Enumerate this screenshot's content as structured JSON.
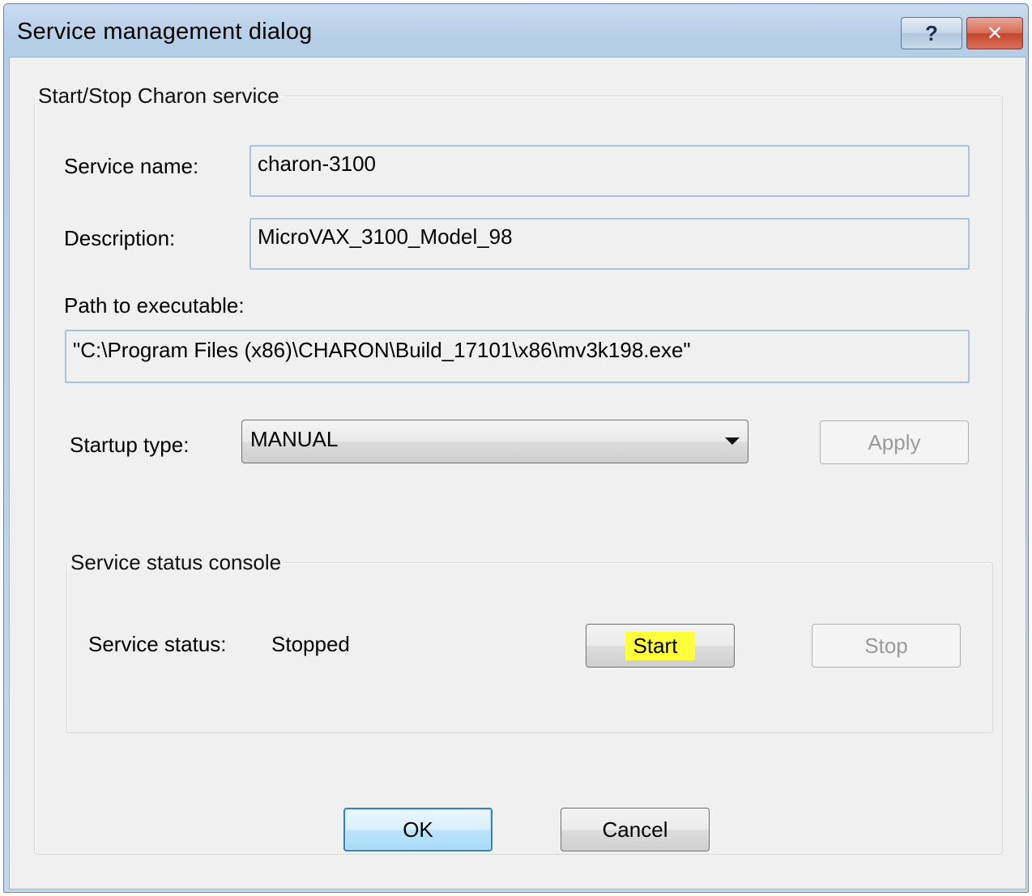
{
  "window": {
    "title": "Service management dialog",
    "help_label": "?",
    "close_label": "✕"
  },
  "service_group": {
    "legend": "Start/Stop Charon service",
    "service_name_label": "Service name:",
    "service_name_value": "charon-3100",
    "description_label": "Description:",
    "description_value": "MicroVAX_3100_Model_98",
    "path_label": "Path to executable:",
    "path_value": "\"C:\\Program Files (x86)\\CHARON\\Build_17101\\x86\\mv3k198.exe\"",
    "startup_label": "Startup type:",
    "startup_value": "MANUAL",
    "apply_label": "Apply"
  },
  "status_group": {
    "legend": "Service status console",
    "status_label": "Service status:",
    "status_value": "Stopped",
    "start_label": "Start",
    "stop_label": "Stop"
  },
  "footer": {
    "ok_label": "OK",
    "cancel_label": "Cancel"
  },
  "colors": {
    "title_bar": "#c4d8ec",
    "close_button": "#d86a54",
    "highlight": "#ffff3a",
    "default_button_border": "#3c7fb1"
  }
}
